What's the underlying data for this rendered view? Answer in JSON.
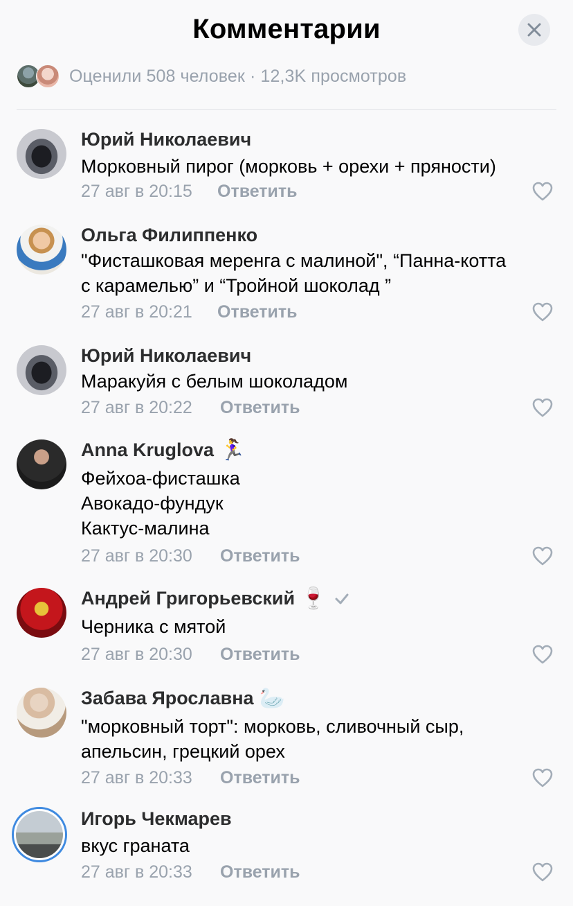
{
  "header": {
    "title": "Комментарии"
  },
  "stats": {
    "text": "Оценили 508 человек · 12,3K просмотров"
  },
  "comments": [
    {
      "author": "Юрий Николаевич",
      "lines": [
        "Морковный пирог (морковь + орехи + пряности)"
      ],
      "time": "27 авг в 20:15",
      "reply": "Ответить"
    },
    {
      "author": "Ольга Филиппенко",
      "lines": [
        "\"Фисташковая меренга с малиной\", “Панна-котта",
        "с карамелью” и “Тройной шоколад ”"
      ],
      "time": "27 авг в 20:21",
      "reply": "Ответить"
    },
    {
      "author": "Юрий Николаевич",
      "lines": [
        "Маракуйя с белым шоколадом"
      ],
      "time": "27 авг в 20:22",
      "reply": "Ответить"
    },
    {
      "author": "Anna Kruglova",
      "emoji": "🏃‍♀️",
      "lines": [
        "Фейхоа-фисташка",
        "Авокадо-фундук",
        "Кактус-малина"
      ],
      "time": "27 авг в 20:30",
      "reply": "Ответить"
    },
    {
      "author": "Андрей Григорьевский",
      "emoji": "🍷",
      "verified": true,
      "lines": [
        "Черника с мятой"
      ],
      "time": "27 авг в 20:30",
      "reply": "Ответить"
    },
    {
      "author": "Забава Ярославна",
      "emoji": "🦢",
      "lines": [
        "\"морковный торт\": морковь, сливочный сыр,",
        "апельсин, грецкий орех"
      ],
      "time": "27 авг в 20:33",
      "reply": "Ответить"
    },
    {
      "author": "Игорь Чекмарев",
      "lines": [
        "вкус граната"
      ],
      "time": "27 авг в 20:33",
      "reply": "Ответить"
    }
  ],
  "colors": {
    "accent": "#3f8ae0",
    "muted": "#99a2ad",
    "background": "#f9f9fa"
  },
  "icons": [
    "close-icon",
    "like-heart-icon",
    "verified-check-icon"
  ]
}
